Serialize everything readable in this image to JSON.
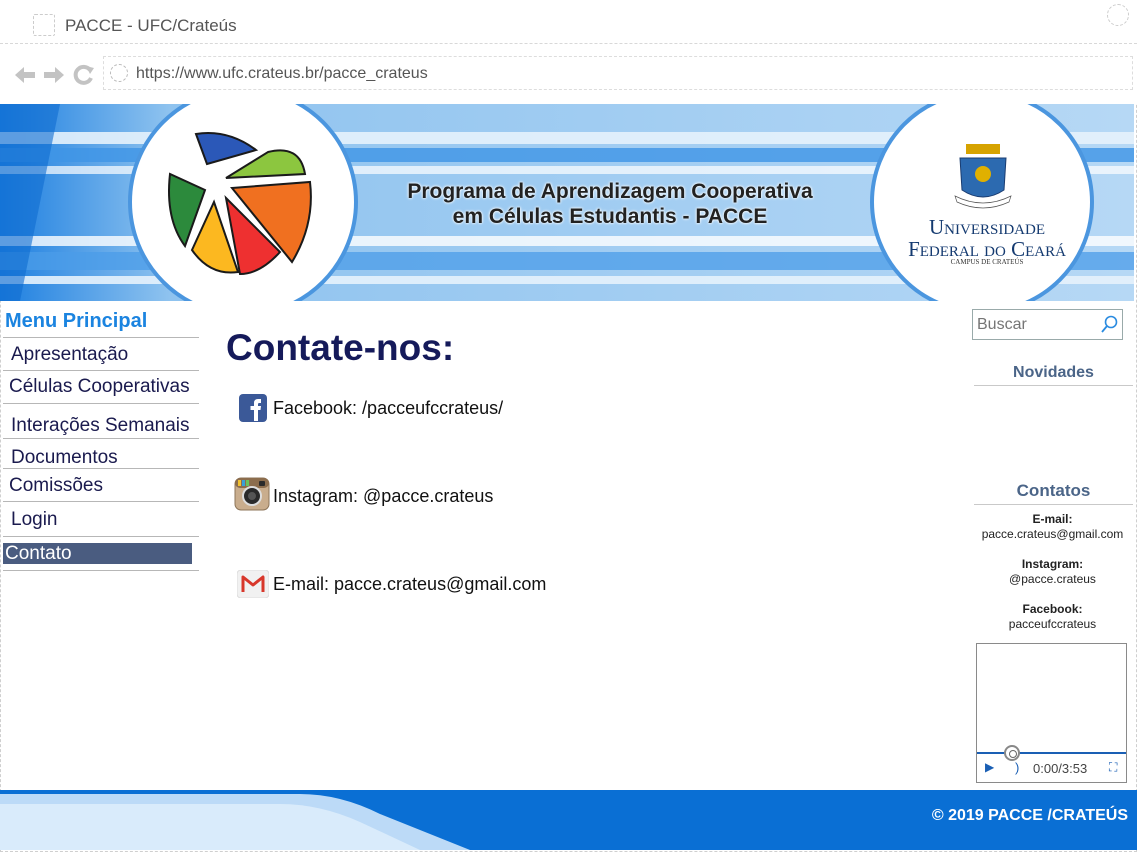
{
  "browser": {
    "tab_title": "PACCE - UFC/Crateús",
    "url": "https://www.ufc.crateus.br/pacce_crateus"
  },
  "banner": {
    "title_line1": "Programa de Aprendizagem Cooperativa",
    "title_line2": "em Células Estudantis - PACCE",
    "university_line1": "Universidade",
    "university_line2": "Federal do Ceará",
    "campus": "Campus de Crateús"
  },
  "menu": {
    "title": "Menu Principal",
    "items": [
      {
        "label": "Apresentação"
      },
      {
        "label": "Células Cooperativas"
      },
      {
        "label": "Interações Semanais"
      },
      {
        "label": "Documentos"
      },
      {
        "label": "Comissões"
      },
      {
        "label": "Login"
      },
      {
        "label": "Contato"
      }
    ]
  },
  "main": {
    "title": "Contate-nos:",
    "contacts": [
      {
        "icon": "facebook-icon",
        "text": "Facebook: /pacceufccrateus/"
      },
      {
        "icon": "instagram-icon",
        "text": "Instagram: @pacce.crateus"
      },
      {
        "icon": "gmail-icon",
        "text": "E-mail: pacce.crateus@gmail.com"
      }
    ]
  },
  "sidebar": {
    "search_placeholder": "Buscar",
    "novidades_title": "Novidades",
    "contatos_title": "Contatos",
    "email_label": "E-mail:",
    "email_value": "pacce.crateus@gmail.com",
    "instagram_label": "Instagram:",
    "instagram_value": "@pacce.crateus",
    "facebook_label": "Facebook:",
    "facebook_value": "pacceufccrateus",
    "audio_time": "0:00/3:53"
  },
  "footer": {
    "text": "© 2019 PACCE /CRATEÚS"
  },
  "colors": {
    "menu_title": "#1b84e0",
    "menu_active_bg": "#4a5c80",
    "main_title": "#151a5a",
    "footer_bg": "#0a6fd4"
  }
}
